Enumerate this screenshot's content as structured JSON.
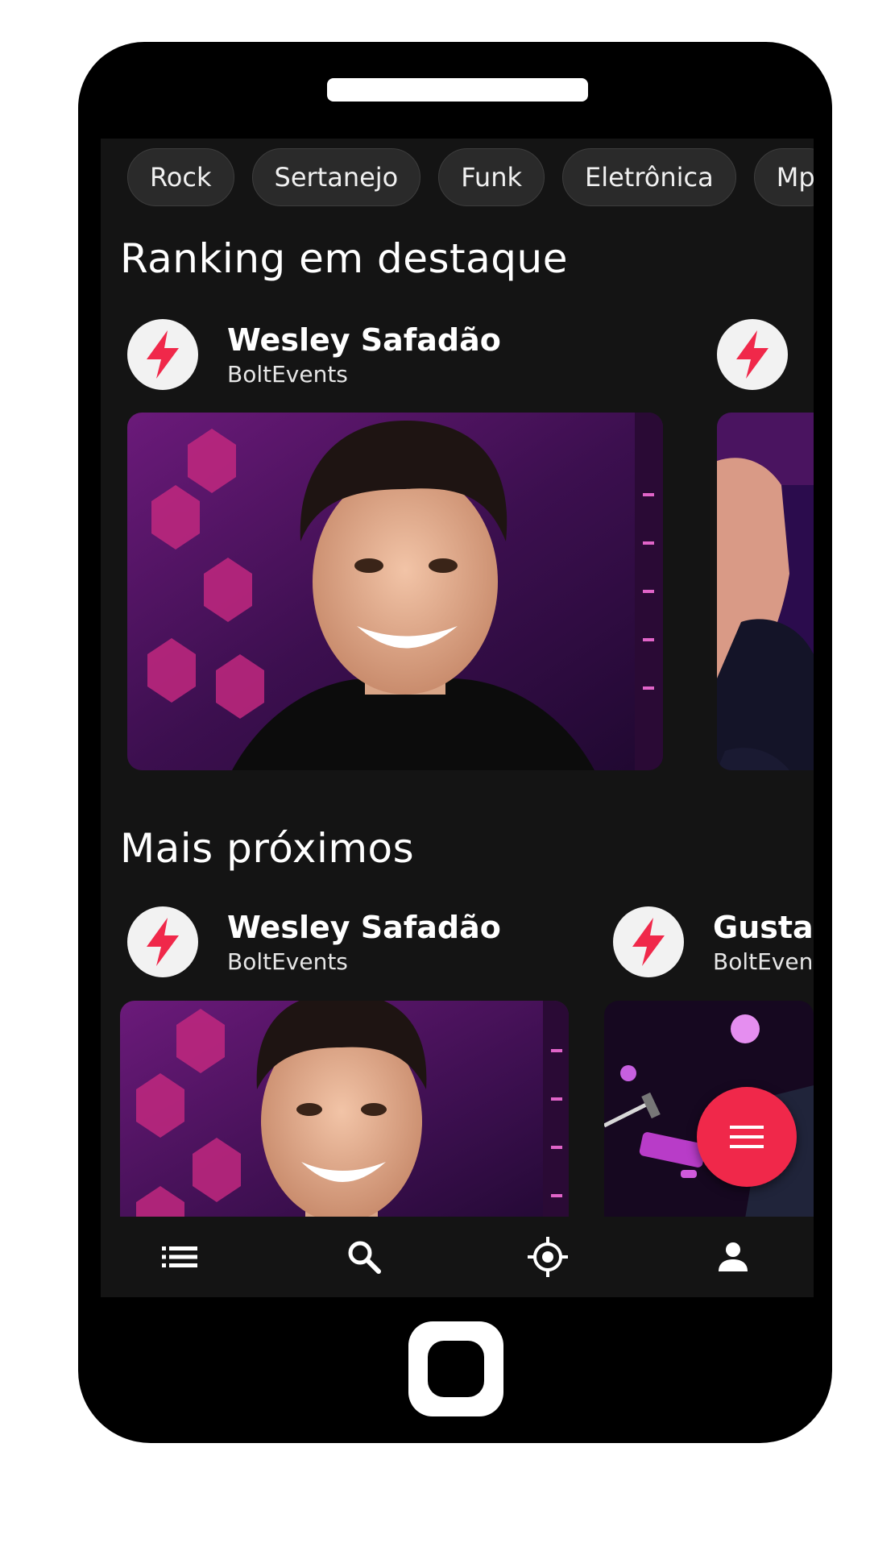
{
  "genre_chips": [
    "Rock",
    "Sertanejo",
    "Funk",
    "Eletrônica",
    "Mp"
  ],
  "sections": {
    "ranking": {
      "title": "Ranking em destaque",
      "cards": [
        {
          "name": "Wesley Safadão",
          "subtitle": "BoltEvents"
        },
        {
          "name": "",
          "subtitle": ""
        }
      ]
    },
    "nearby": {
      "title": "Mais próximos",
      "cards": [
        {
          "name": "Wesley Safadão",
          "subtitle": "BoltEvents"
        },
        {
          "name": "Gustav",
          "subtitle": "BoltEven"
        }
      ]
    }
  },
  "fab": {
    "icon": "menu-icon"
  },
  "bottom_nav": [
    {
      "icon": "list-icon"
    },
    {
      "icon": "search-icon"
    },
    {
      "icon": "location-target-icon"
    },
    {
      "icon": "person-icon"
    }
  ],
  "colors": {
    "accent": "#f0284a",
    "background": "#141414",
    "chip_bg": "#2a2a2a"
  }
}
